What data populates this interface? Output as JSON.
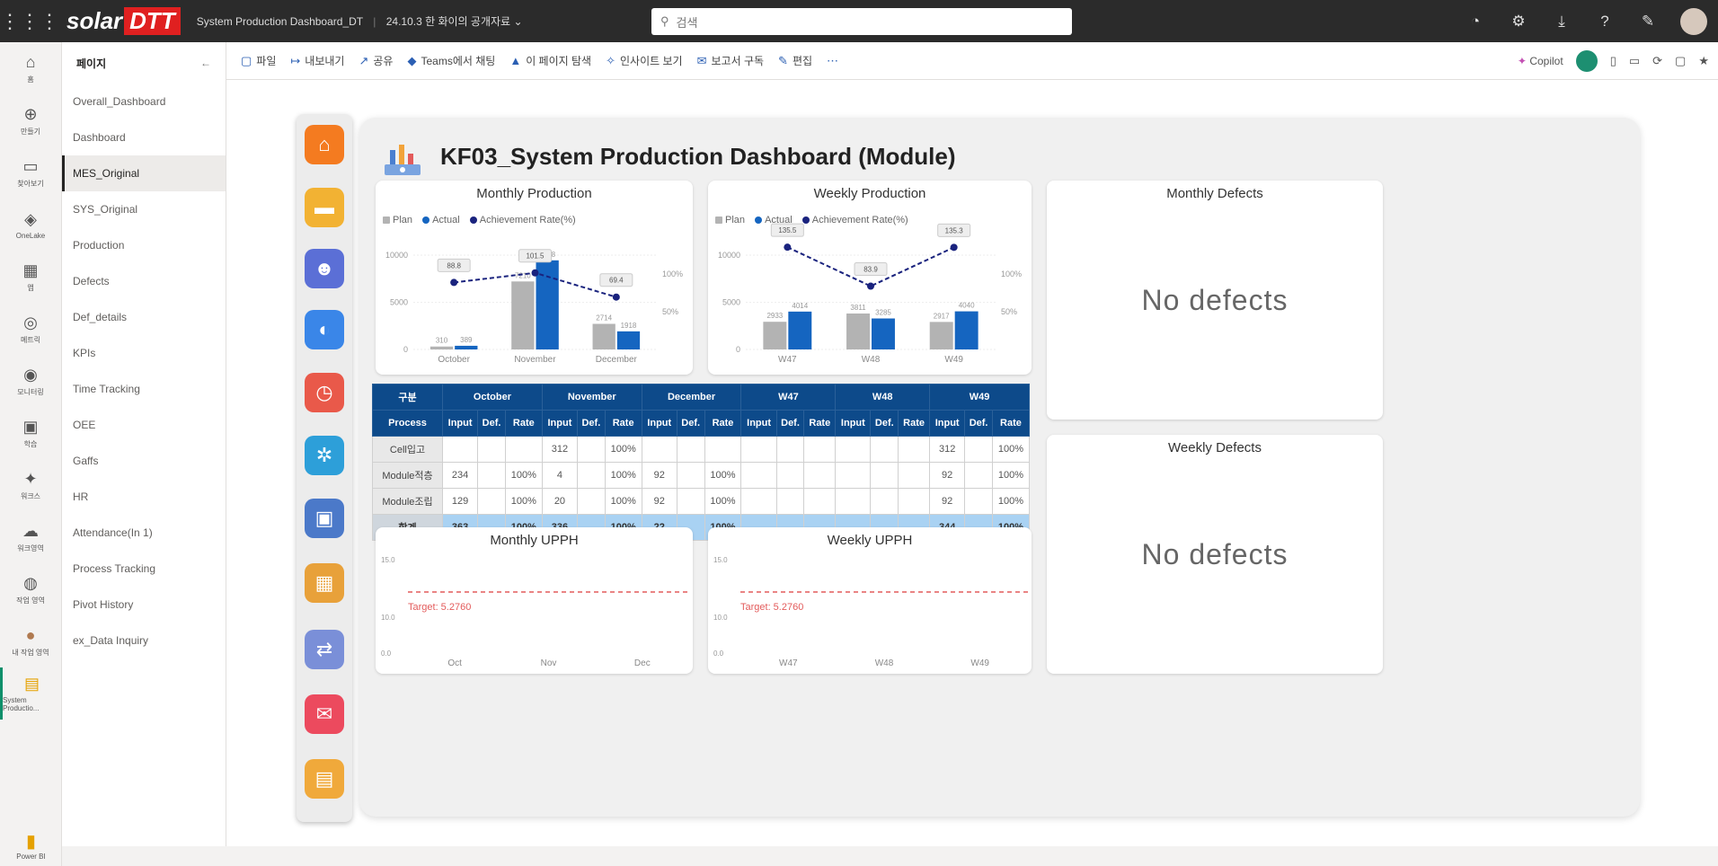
{
  "app": {
    "logo_a": "solar",
    "logo_b": "DTT",
    "report_title": "System Production Dashboard_DT",
    "sensitivity": "24.10.3 한 화이의 공개자료",
    "search_placeholder": "검색"
  },
  "rail": [
    {
      "icon": "home-icon",
      "glyph": "⌂",
      "label": "홈"
    },
    {
      "icon": "create-icon",
      "glyph": "⊕",
      "label": "만들기"
    },
    {
      "icon": "browse-icon",
      "glyph": "▭",
      "label": "찾아보기"
    },
    {
      "icon": "onelake-icon",
      "glyph": "◈",
      "label": "OneLake"
    },
    {
      "icon": "apps-icon",
      "glyph": "▦",
      "label": "앱"
    },
    {
      "icon": "goals-icon",
      "glyph": "◎",
      "label": "메트릭"
    },
    {
      "icon": "monitor-icon",
      "glyph": "◉",
      "label": "모니터링"
    },
    {
      "icon": "learn-icon",
      "glyph": "▣",
      "label": "학습"
    },
    {
      "icon": "workspace-icon",
      "glyph": "✦",
      "label": "워크스"
    },
    {
      "icon": "workspace2-icon",
      "glyph": "☁",
      "label": "워크영역"
    },
    {
      "icon": "workspace3-icon",
      "glyph": "◍",
      "label": "작업 영역"
    },
    {
      "icon": "user-ws-icon",
      "glyph": "●",
      "label": "내 작업 영역"
    },
    {
      "icon": "report-icon",
      "glyph": "▤",
      "label": "System Productio..."
    }
  ],
  "rail_bottom": "Power BI",
  "pages": {
    "header": "페이지",
    "items": [
      "Overall_Dashboard",
      "Dashboard",
      "MES_Original",
      "SYS_Original",
      "Production",
      "Defects",
      "Def_details",
      "KPIs",
      "Time Tracking",
      "OEE",
      "Gaffs",
      "HR",
      "Attendance(In 1)",
      "Process Tracking",
      "Pivot History",
      "ex_Data Inquiry"
    ],
    "active_index": 2
  },
  "ribbon": {
    "items": [
      {
        "icon": "file-icon",
        "glyph": "▢",
        "label": "파일"
      },
      {
        "icon": "export-icon",
        "glyph": "↦",
        "label": "내보내기"
      },
      {
        "icon": "share-icon",
        "glyph": "↗",
        "label": "공유"
      },
      {
        "icon": "teams-icon",
        "glyph": "◆",
        "label": "Teams에서 채팅"
      },
      {
        "icon": "insights-icon",
        "glyph": "▲",
        "label": "이 페이지 탐색"
      },
      {
        "icon": "bulb-icon",
        "glyph": "✧",
        "label": "인사이트 보기"
      },
      {
        "icon": "subscribe-icon",
        "glyph": "✉",
        "label": "보고서 구독"
      },
      {
        "icon": "edit-icon",
        "glyph": "✎",
        "label": "편집"
      },
      {
        "icon": "more-icon",
        "glyph": "⋯",
        "label": ""
      }
    ],
    "copilot": "Copilot"
  },
  "dashboard": {
    "title": "KF03_System Production Dashboard (Module)",
    "monthly_title": "Monthly Production",
    "weekly_title": "Weekly Production",
    "monthly_defects_title": "Monthly Defects",
    "weekly_defects_title": "Weekly Defects",
    "monthly_uph_title": "Monthly UPPH",
    "weekly_uph_title": "Weekly UPPH",
    "no_defects": "No defects",
    "legend": {
      "plan": "Plan",
      "actual": "Actual",
      "rate": "Achievement Rate(%)"
    },
    "colors": {
      "plan": "#b3b3b3",
      "actual": "#1565c0",
      "rate": "#1a237e",
      "target": "#e35b5b",
      "header": "#0d4a8a",
      "total": "#a9d2f3"
    }
  },
  "chart_data": [
    {
      "type": "bar",
      "title": "Monthly Production",
      "categories": [
        "October",
        "November",
        "December"
      ],
      "series": [
        {
          "name": "Plan",
          "values": [
            310,
            7210,
            2714
          ]
        },
        {
          "name": "Actual",
          "values": [
            389,
            9448,
            1918
          ]
        },
        {
          "name": "Achievement Rate(%)",
          "values": [
            88.8,
            101.5,
            69.4
          ],
          "kind": "line"
        }
      ],
      "y_ticks": [
        "0",
        "5000",
        "10000"
      ],
      "y2_ticks": [
        "50%",
        "100%"
      ],
      "ylim": [
        0,
        12000
      ]
    },
    {
      "type": "bar",
      "title": "Weekly Production",
      "categories": [
        "W47",
        "W48",
        "W49"
      ],
      "series": [
        {
          "name": "Plan",
          "values": [
            2933,
            3811,
            2917
          ]
        },
        {
          "name": "Actual",
          "values": [
            4014,
            3285,
            4040
          ]
        },
        {
          "name": "Achievement Rate(%)",
          "values": [
            135.5,
            83.9,
            135.3
          ],
          "kind": "line"
        }
      ],
      "y_ticks": [
        "0",
        "5000",
        "10000"
      ],
      "y2_ticks": [
        "50%",
        "100%"
      ],
      "ylim": [
        0,
        12000
      ]
    },
    {
      "type": "line",
      "title": "Monthly UPPH",
      "categories": [
        "Oct",
        "Nov",
        "Dec"
      ],
      "y_ticks": [
        "0.0",
        "10.0",
        "15.0"
      ],
      "target_label": "Target: 5.2760",
      "ylim": [
        0,
        20
      ]
    },
    {
      "type": "line",
      "title": "Weekly UPPH",
      "categories": [
        "W47",
        "W48",
        "W49"
      ],
      "y_ticks": [
        "0.0",
        "10.0",
        "15.0"
      ],
      "target_label": "Target: 5.2760",
      "ylim": [
        0,
        20
      ]
    },
    {
      "type": "table",
      "group_header": [
        "구분",
        "October",
        "November",
        "December",
        "W47",
        "W48",
        "W49"
      ],
      "sub_header": [
        "Process",
        "Input",
        "Def.",
        "Rate",
        "Input",
        "Def.",
        "Rate",
        "Input",
        "Def.",
        "Rate",
        "Input",
        "Def.",
        "Rate",
        "Input",
        "Def.",
        "Rate",
        "Input",
        "Def.",
        "Rate"
      ],
      "rows": [
        [
          "Cell입고",
          "",
          "",
          "",
          "312",
          "",
          "100%",
          "",
          "",
          "",
          "",
          "",
          "",
          "",
          "",
          "",
          "312",
          "",
          "100%"
        ],
        [
          "Module적층",
          "234",
          "",
          "100%",
          "4",
          "",
          "100%",
          "92",
          "",
          "100%",
          "",
          "",
          "",
          "",
          "",
          "",
          "92",
          "",
          "100%"
        ],
        [
          "Module조립",
          "129",
          "",
          "100%",
          "20",
          "",
          "100%",
          "92",
          "",
          "100%",
          "",
          "",
          "",
          "",
          "",
          "",
          "92",
          "",
          "100%"
        ],
        [
          "합계",
          "363",
          "",
          "100%",
          "336",
          "",
          "100%",
          "22",
          "",
          "100%",
          "",
          "",
          "",
          "",
          "",
          "",
          "344",
          "",
          "100%"
        ]
      ]
    }
  ]
}
